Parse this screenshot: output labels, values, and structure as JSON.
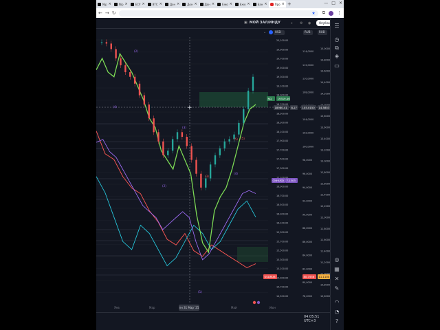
{
  "browser": {
    "tabs": [
      {
        "label": "Nip",
        "favicon": "tv-icon"
      },
      {
        "label": "Nip",
        "favicon": "tv-icon"
      },
      {
        "label": "ЕСУ",
        "favicon": "tv-icon"
      },
      {
        "label": "ВТС",
        "favicon": "tv-icon"
      },
      {
        "label": "Дон",
        "favicon": "tv-icon"
      },
      {
        "label": "Дон",
        "favicon": "tv-icon"
      },
      {
        "label": "Дон",
        "favicon": "tv-icon"
      },
      {
        "label": "Ежо",
        "favicon": "tv-icon"
      },
      {
        "label": "Ежо",
        "favicon": "tv-icon"
      },
      {
        "label": "Бан",
        "favicon": "tv-icon"
      },
      {
        "label": "Про",
        "favicon": "youtube-icon"
      }
    ],
    "new_tab": "+",
    "window_controls": [
      "—",
      "□",
      "✕"
    ]
  },
  "tv": {
    "title": "МОЙ ЗАЛ/ИНДУ",
    "publish_label": "Опубликовать",
    "currency_left": "USD",
    "currency_mid": "RUB",
    "currency_right": "RUB"
  },
  "price_axes": {
    "left": [
      "20,100.00",
      "19,900.00",
      "19,700.00",
      "19,500.00",
      "19,300.00",
      "19,100.00",
      "18,900.00",
      "18,700.00",
      "18,500.00",
      "18,300.00",
      "18,100.00",
      "17,900.00",
      "17,700.00",
      "17,500.00",
      "17,300.00",
      "17,100.00",
      "16,900.00",
      "16,700.00",
      "16,500.00",
      "16,300.00",
      "16,100.00",
      "15,900.00",
      "15,700.00",
      "15,500.00",
      "15,300.00",
      "15,100.00",
      "14,900.00",
      "14,700.00",
      "14,500.00"
    ],
    "mid": [
      "114,0000",
      "112,0000",
      "110,0000",
      "108,0000",
      "106,0000",
      "104,0000",
      "102,0000",
      "100,0000",
      "98,0000",
      "96,0000",
      "94,0000",
      "92,0000",
      "90,0000",
      "88,0000",
      "86,0000",
      "84,0000",
      "82,0000",
      "80,0000",
      "78,0000"
    ],
    "right": [
      "15,0000",
      "14,8000",
      "14,6000",
      "14,4000",
      "14,2000",
      "14,0000",
      "13,8000",
      "13,6000",
      "13,4000",
      "13,2000",
      "13,0000",
      "12,8000",
      "12,6000",
      "12,4000",
      "12,2000",
      "12,0000",
      "11,8000",
      "11,6000",
      "11,4000",
      "11,2000",
      "11,0000",
      "10,8000",
      "10,6000"
    ]
  },
  "badges": {
    "nq_symbol": "NQ",
    "nq_price": "19319.46",
    "cross_price": "18980.41",
    "cross_delta": "8.27",
    "cross_mid": "105.0150",
    "cross_right": "14.5853",
    "cnh_label": "CNHUSD",
    "cnh_price": "7.1303",
    "usdrub_label": "USDRUB",
    "usdrub_price": "80.7556",
    "usdrub_right": "11.1100"
  },
  "wave_labels": [
    "(2)",
    "(4)",
    "(3)",
    "(5)",
    "(1)",
    "(2)",
    "(5)",
    "(4)",
    "(3)"
  ],
  "time_axis": {
    "labels": [
      "Янв",
      "Мар",
      "Май",
      "Июн"
    ],
    "cursor": "пн 31 Мар '25",
    "clock": "04:05:51 UTC+3"
  },
  "chart_data": {
    "type": "line",
    "series": [
      {
        "name": "NQ",
        "type": "candlestick",
        "values": [
          20050,
          20020,
          19900,
          19700,
          19550,
          19400,
          19300,
          19150,
          18900,
          18700,
          18400,
          18100,
          17900,
          17600,
          17700,
          17950,
          18100,
          18000,
          17800,
          17500,
          17200,
          16900,
          17100,
          17400,
          17600,
          17750,
          17900,
          17950,
          18050,
          18300,
          18600,
          19000,
          19300
        ]
      },
      {
        "name": "",
        "color": "#7cd955",
        "values": [
          19450,
          19700,
          19400,
          19300,
          19800,
          19600,
          19400,
          19100,
          18800,
          18400,
          18200,
          17700,
          17500,
          17300,
          17800,
          17500,
          17200,
          16300,
          15700,
          15500,
          16400,
          16700,
          16900,
          17300,
          17800,
          18300,
          18600,
          18700
        ]
      },
      {
        "name": "",
        "color": "#9b6af0",
        "values": [
          104.5,
          105,
          103,
          102,
          100,
          98,
          96,
          94,
          93,
          92,
          90,
          91,
          92,
          93,
          92,
          88,
          85,
          86,
          88,
          90,
          92,
          94,
          96,
          96.5,
          96
        ]
      },
      {
        "name": "",
        "color": "#26c6da",
        "values": [
          13.6,
          13.2,
          12.6,
          12,
          11.8,
          12.4,
          12.2,
          11.8,
          11.4,
          11.6,
          12,
          12.4,
          12.2,
          11.8,
          12,
          12.4,
          12.8,
          13,
          12.6
        ]
      },
      {
        "name": "",
        "color": "#ef5350",
        "values": [
          104,
          100,
          99,
          96,
          94,
          93,
          90,
          88,
          85,
          84,
          86,
          83,
          82,
          84,
          83,
          82,
          81,
          80,
          80.7
        ]
      }
    ]
  }
}
